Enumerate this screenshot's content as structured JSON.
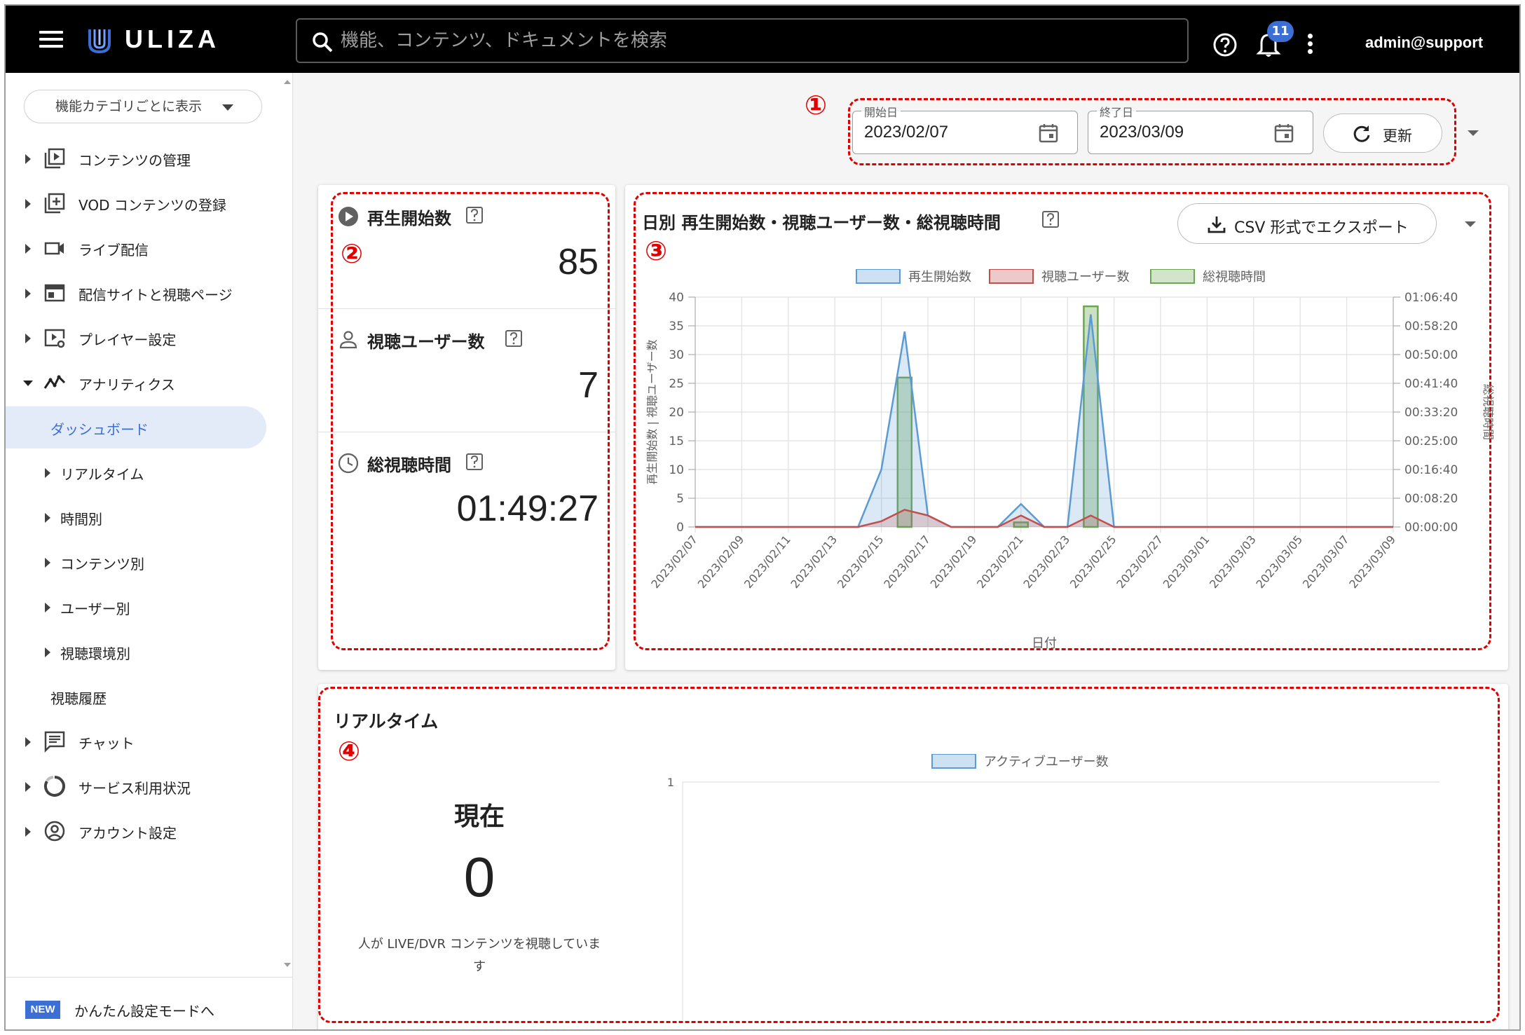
{
  "topbar": {
    "brand": "ULIZA",
    "search_placeholder": "機能、コンテンツ、ドキュメントを検索",
    "notification_count": "11",
    "user": "admin@support"
  },
  "sidebar": {
    "category_button": "機能カテゴリごとに表示",
    "items": [
      {
        "label": "コンテンツの管理",
        "icon": "play-box-icon"
      },
      {
        "label": "VOD コンテンツの登録",
        "icon": "add-box-icon"
      },
      {
        "label": "ライブ配信",
        "icon": "video-camera-icon"
      },
      {
        "label": "配信サイトと視聴ページ",
        "icon": "web-page-icon"
      },
      {
        "label": "プレイヤー設定",
        "icon": "player-settings-icon"
      },
      {
        "label": "アナリティクス",
        "icon": "analytics-icon"
      },
      {
        "label": "ダッシュボード"
      },
      {
        "label": "リアルタイム"
      },
      {
        "label": "時間別"
      },
      {
        "label": "コンテンツ別"
      },
      {
        "label": "ユーザー別"
      },
      {
        "label": "視聴環境別"
      },
      {
        "label": "視聴履歴"
      },
      {
        "label": "チャット",
        "icon": "chat-icon"
      },
      {
        "label": "サービス利用状況",
        "icon": "usage-icon"
      },
      {
        "label": "アカウント設定",
        "icon": "account-icon"
      }
    ],
    "new_badge": "NEW",
    "easy_mode": "かんたん設定モードへ"
  },
  "filters": {
    "start_label": "開始日",
    "start_value": "2023/02/07",
    "end_label": "終了日",
    "end_value": "2023/03/09",
    "refresh": "更新"
  },
  "stats": [
    {
      "title": "再生開始数",
      "value": "85",
      "icon": "play-circle-icon"
    },
    {
      "title": "視聴ユーザー数",
      "value": "7",
      "icon": "person-icon"
    },
    {
      "title": "総視聴時間",
      "value": "01:49:27",
      "icon": "clock-icon"
    }
  ],
  "daily": {
    "title": "日別 再生開始数・視聴ユーザー数・総視聴時間",
    "csv_button": "CSV 形式でエクスポート"
  },
  "chart_data": [
    {
      "type": "line",
      "x": [
        "2023/02/07",
        "2023/02/08",
        "2023/02/09",
        "2023/02/10",
        "2023/02/11",
        "2023/02/12",
        "2023/02/13",
        "2023/02/14",
        "2023/02/15",
        "2023/02/16",
        "2023/02/17",
        "2023/02/18",
        "2023/02/19",
        "2023/02/20",
        "2023/02/21",
        "2023/02/22",
        "2023/02/23",
        "2023/02/24",
        "2023/02/25",
        "2023/02/26",
        "2023/02/27",
        "2023/02/28",
        "2023/03/01",
        "2023/03/02",
        "2023/03/03",
        "2023/03/04",
        "2023/03/05",
        "2023/03/06",
        "2023/03/07",
        "2023/03/08",
        "2023/03/09"
      ],
      "x_tick_labels": [
        "2023/02/07",
        "2023/02/09",
        "2023/02/11",
        "2023/02/13",
        "2023/02/15",
        "2023/02/17",
        "2023/02/19",
        "2023/02/21",
        "2023/02/23",
        "2023/02/25",
        "2023/02/27",
        "2023/03/01",
        "2023/03/03",
        "2023/03/05",
        "2023/03/07",
        "2023/03/09"
      ],
      "series": [
        {
          "name": "再生開始数",
          "kind": "area",
          "axis": "left",
          "color": "#5b9bd5",
          "values": [
            0,
            0,
            0,
            0,
            0,
            0,
            0,
            0,
            10,
            34,
            2,
            0,
            0,
            0,
            4,
            0,
            0,
            37,
            0,
            0,
            0,
            0,
            0,
            0,
            0,
            0,
            0,
            0,
            0,
            0,
            0
          ]
        },
        {
          "name": "視聴ユーザー数",
          "kind": "area",
          "axis": "left",
          "color": "#c0504d",
          "values": [
            0,
            0,
            0,
            0,
            0,
            0,
            0,
            0,
            1,
            3,
            2,
            0,
            0,
            0,
            2,
            0,
            0,
            2,
            0,
            0,
            0,
            0,
            0,
            0,
            0,
            0,
            0,
            0,
            0,
            0,
            0
          ]
        },
        {
          "name": "総視聴時間",
          "kind": "bar",
          "axis": "right",
          "color": "#6aa84f",
          "values": [
            0,
            0,
            0,
            0,
            0,
            0,
            0,
            0,
            0,
            2600,
            0,
            0,
            0,
            0,
            80,
            0,
            0,
            3840,
            0,
            0,
            0,
            0,
            0,
            0,
            0,
            0,
            0,
            0,
            0,
            0,
            0
          ]
        }
      ],
      "ylim": [
        0,
        40
      ],
      "y_ticks": [
        "0",
        "5",
        "10",
        "15",
        "20",
        "25",
        "30",
        "35",
        "40"
      ],
      "y2_ticks": [
        "00:00:00",
        "00:08:20",
        "00:16:40",
        "00:25:00",
        "00:33:20",
        "00:41:40",
        "00:50:00",
        "00:58:20",
        "01:06:40"
      ],
      "xlabel": "日付",
      "ylabel": "再生開始数 | 視聴ユーザー数",
      "y2label": "総視聴時間",
      "grid": true,
      "legend": "top"
    },
    {
      "type": "area",
      "series": [
        {
          "name": "アクティブユーザー数",
          "color": "#5b9bd5",
          "values": []
        }
      ],
      "y_ticks": [
        "1"
      ],
      "legend": "top"
    }
  ],
  "realtime": {
    "title": "リアルタイム",
    "now_label": "現在",
    "value": "0",
    "desc": "人が LIVE/DVR コンテンツを視聴しています"
  },
  "annotations": [
    "①",
    "②",
    "③",
    "④"
  ]
}
